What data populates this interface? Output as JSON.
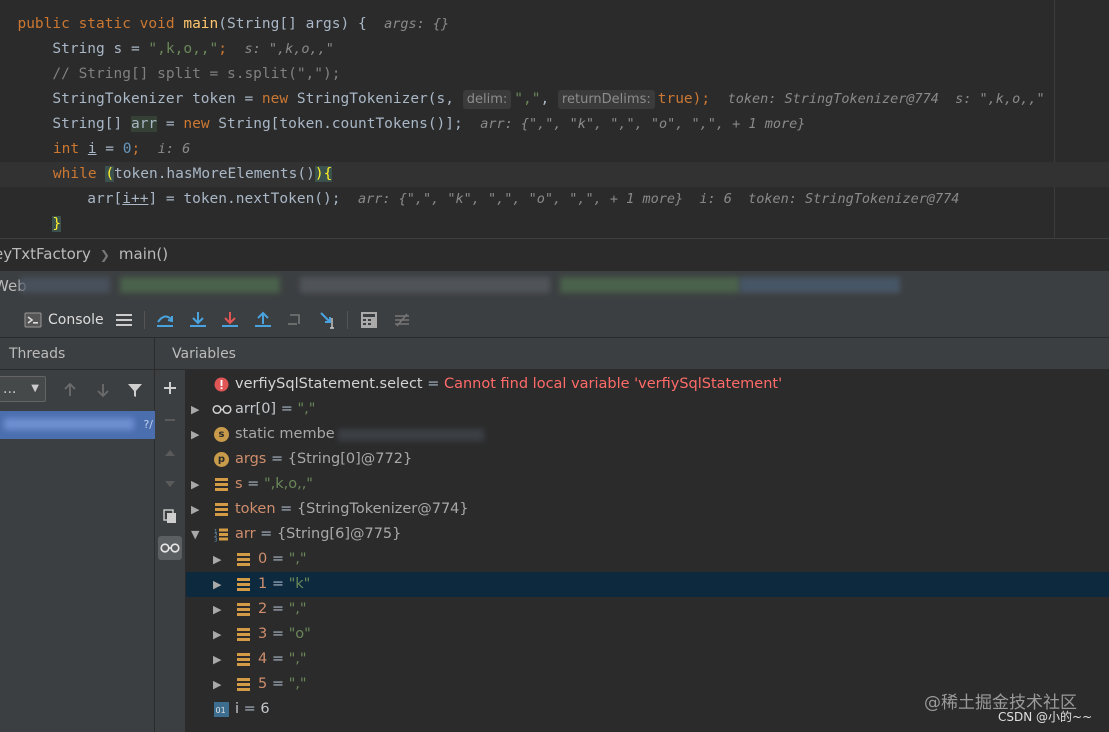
{
  "editor": {
    "lines": {
      "l1": {
        "kw1": "public static void ",
        "fn": "main",
        "rest": "(String[] args) {",
        "inline": "args: {}"
      },
      "l2": {
        "pre": "    String s = ",
        "str": "\",k,o,,\"",
        "semi": ";",
        "inline": "s: \",k,o,,\""
      },
      "l3": {
        "comment": "    // String[] split = s.split(\",\");"
      },
      "l4": {
        "pre": "    StringTokenizer token = ",
        "kw": "new",
        "mid": " StringTokenizer(s, ",
        "hint1": "delim:",
        "str": "\",\"",
        "comma": ", ",
        "hint2": "returnDelims:",
        "kw2": "true",
        "end": ");",
        "inline": "token: StringTokenizer@774  s: \",k,o,,\""
      },
      "l5": {
        "pre": "    String[] ",
        "var": "arr",
        "eq": " = ",
        "kw": "new",
        "rest": " String[token.countTokens()];",
        "inline": "arr: {\",\", \"k\", \",\", \"o\", \",\", + 1 more}"
      },
      "l6": {
        "kw": "    int ",
        "var": "i",
        "eq": " = ",
        "num": "0",
        "semi": ";",
        "inline": "i: 6"
      },
      "l7": {
        "kw": "    while ",
        "paren": "(",
        "rest": "token.hasMoreElements()",
        "close": ")",
        "brace": "{"
      },
      "l8": {
        "pre": "        arr[",
        "var": "i++",
        "rest": "] = token.nextToken();",
        "inline": "arr: {\",\", \"k\", \",\", \"o\", \",\", + 1 more}  i: 6  token: StringTokenizer@774"
      },
      "l9": {
        "brace": "}"
      }
    }
  },
  "breadcrumb": {
    "file": "eyTxtFactory",
    "method": "main()"
  },
  "debug": {
    "title_prefix": "Web"
  },
  "toolbar": {
    "console_label": "Console"
  },
  "threads": {
    "header": "Threads",
    "combo_value": "...",
    "selected_tail": "?/"
  },
  "variables": {
    "header": "Variables",
    "rows": [
      {
        "name": "verfiySqlStatement.select",
        "eq": " = ",
        "value": "Cannot find local variable 'verfiySqlStatement'",
        "kind": "error",
        "icon": "error-icon"
      },
      {
        "name": "arr[0]",
        "eq": " = ",
        "value": "\",\"",
        "kind": "watch",
        "icon": "watch-glasses-icon"
      },
      {
        "name": "static membe",
        "eq": "",
        "value": "",
        "kind": "static",
        "icon": "static-icon"
      },
      {
        "name": "args",
        "eq": " = ",
        "value": "{String[0]@772}",
        "kind": "param",
        "icon": "parameter-icon"
      },
      {
        "name": "s",
        "eq": " = ",
        "value": "\",k,o,,\"",
        "kind": "local",
        "icon": "field-icon"
      },
      {
        "name": "token",
        "eq": " = ",
        "value": "{StringTokenizer@774}",
        "kind": "local",
        "icon": "field-icon"
      },
      {
        "name": "arr",
        "eq": " = ",
        "value": "{String[6]@775}",
        "kind": "array",
        "icon": "array-icon"
      },
      {
        "name": "0",
        "eq": " = ",
        "value": "\",\"",
        "kind": "elem",
        "icon": "field-icon"
      },
      {
        "name": "1",
        "eq": " = ",
        "value": "\"k\"",
        "kind": "elem",
        "icon": "field-icon"
      },
      {
        "name": "2",
        "eq": " = ",
        "value": "\",\"",
        "kind": "elem",
        "icon": "field-icon"
      },
      {
        "name": "3",
        "eq": " = ",
        "value": "\"o\"",
        "kind": "elem",
        "icon": "field-icon"
      },
      {
        "name": "4",
        "eq": " = ",
        "value": "\",\"",
        "kind": "elem",
        "icon": "field-icon"
      },
      {
        "name": "5",
        "eq": " = ",
        "value": "\",\"",
        "kind": "elem",
        "icon": "field-icon"
      },
      {
        "name": "i",
        "eq": " = ",
        "value": "6",
        "kind": "primitive",
        "icon": "primitive-icon"
      }
    ]
  },
  "watermark": {
    "line1": "@稀土掘金技术社区",
    "line2": "CSDN @小的~~"
  },
  "colors": {
    "accent": "#4b6eaf",
    "selection": "#0d293e",
    "error": "#ff6b68",
    "string": "#6a8759",
    "keyword": "#cc7832"
  }
}
